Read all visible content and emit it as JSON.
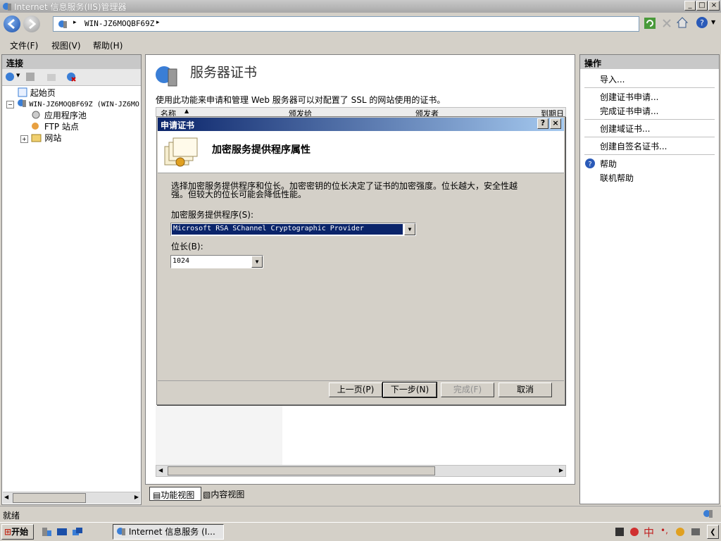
{
  "window": {
    "title": "Internet 信息服务(IIS)管理器",
    "minimize": "_",
    "maximize": "□",
    "close": "×"
  },
  "address": {
    "path": "WIN-JZ6MOQBF69Z",
    "sep": "▸"
  },
  "menu": {
    "file": "文件(F)",
    "view": "视图(V)",
    "help": "帮助(H)"
  },
  "connections": {
    "header": "连接",
    "tree": {
      "start": "起始页",
      "server": "WIN-JZ6MOQBF69Z (WIN-JZ6MO",
      "apppools": "应用程序池",
      "ftp": "FTP 站点",
      "sites": "网站"
    }
  },
  "center": {
    "title": "服务器证书",
    "description": "使用此功能来申请和管理 Web 服务器可以对配置了 SSL 的网站使用的证书。",
    "columns": [
      "名称",
      "颁发给",
      "颁发者",
      "到期日"
    ],
    "tabs": {
      "feature": "功能视图",
      "content": "内容视图"
    }
  },
  "actions": {
    "header": "操作",
    "import": "导入...",
    "create_request": "创建证书申请...",
    "complete_request": "完成证书申请...",
    "create_domain": "创建域证书...",
    "create_selfsigned": "创建自签名证书...",
    "help": "帮助",
    "online_help": "联机帮助"
  },
  "dialog": {
    "title": "申请证书",
    "help_btn": "?",
    "close_btn": "×",
    "heading": "加密服务提供程序属性",
    "instructions_line1": "选择加密服务提供程序和位长。加密密钥的位长决定了证书的加密强度。位长越大，安全性越",
    "instructions_line2": "强。但较大的位长可能会降低性能。",
    "provider_label": "加密服务提供程序(S):",
    "provider_value": "Microsoft RSA SChannel Cryptographic Provider",
    "bitlength_label": "位长(B):",
    "bitlength_value": "1024",
    "buttons": {
      "prev": "上一页(P)",
      "next": "下一步(N)",
      "finish": "完成(F)",
      "cancel": "取消"
    }
  },
  "status": {
    "text": "就绪"
  },
  "taskbar": {
    "start": "开始",
    "task": "Internet 信息服务 (I...",
    "ime": "中"
  }
}
